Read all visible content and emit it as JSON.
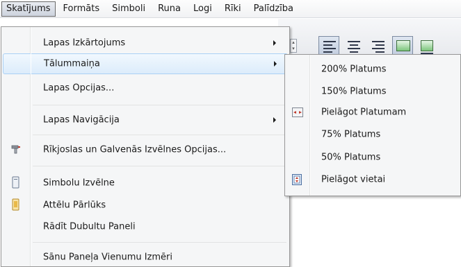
{
  "menubar": {
    "items": [
      {
        "label": "Skatījums",
        "active": true
      },
      {
        "label": "Formāts"
      },
      {
        "label": "Simboli"
      },
      {
        "label": "Runa"
      },
      {
        "label": "Logi"
      },
      {
        "label": "Rīki"
      },
      {
        "label": "Palīdzība"
      }
    ]
  },
  "view_menu": {
    "items": [
      {
        "label": "Lapas Izkārtojums",
        "submenu": true
      },
      {
        "label": "Tālummaiņa",
        "submenu": true,
        "highlighted": true
      },
      {
        "label": "Lapas Opcijas..."
      },
      {
        "label": "Lapas Navigācija",
        "submenu": true
      },
      {
        "label": "Rīkjoslas un Galvenās Izvēlnes Opcijas...",
        "icon": "toolbar-options-icon"
      },
      {
        "label": "Simbolu Izvēlne",
        "icon": "symbol-palette-icon"
      },
      {
        "label": "Attēlu Pārlūks",
        "icon": "image-browser-icon"
      },
      {
        "label": "Rādīt Dubultu Paneli"
      },
      {
        "label": "Sānu Paneļa Vienumu Izmēri"
      }
    ]
  },
  "zoom_submenu": {
    "items": [
      {
        "label": "200% Platums"
      },
      {
        "label": "150% Platums"
      },
      {
        "label": "Pielāgot Platumam",
        "icon": "fit-width-icon"
      },
      {
        "label": "75% Platums"
      },
      {
        "label": "50% Platums"
      },
      {
        "label": "Pielāgot vietai",
        "icon": "fit-page-icon"
      }
    ]
  }
}
